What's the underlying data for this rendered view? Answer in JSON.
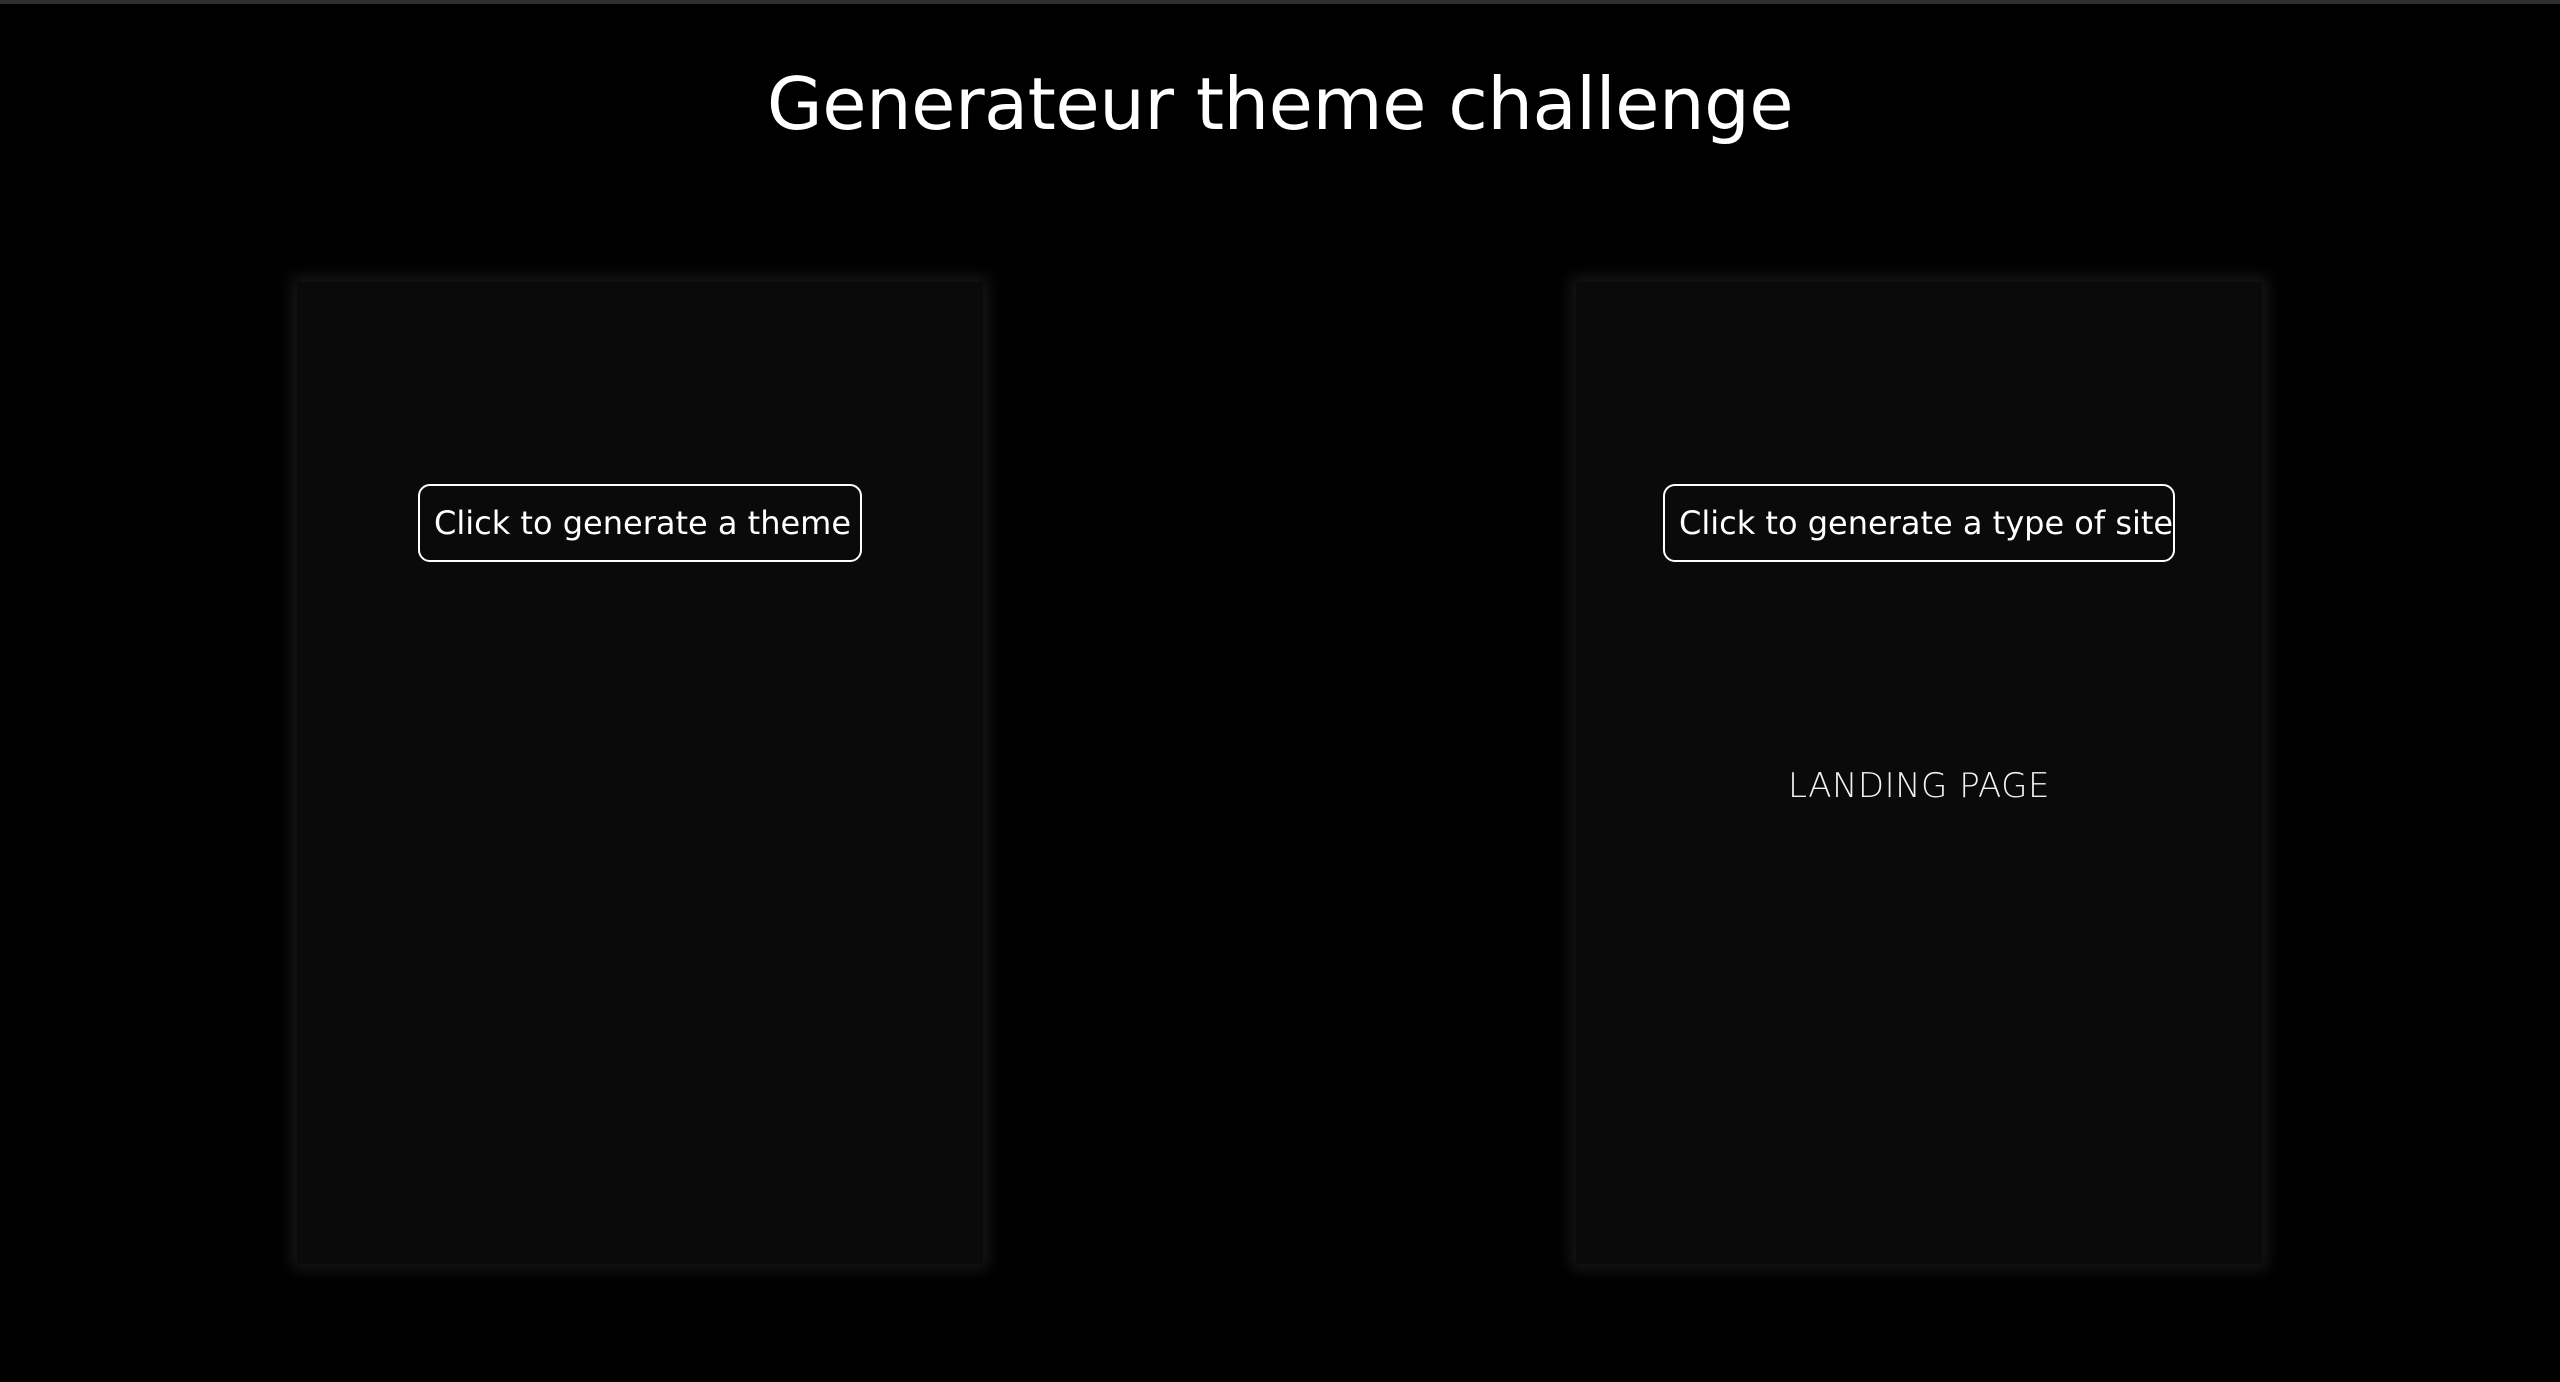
{
  "page": {
    "title": "Generateur theme challenge"
  },
  "theme_panel": {
    "button_label": "Click to generate a theme",
    "result": ""
  },
  "site_panel": {
    "button_label": "Click to generate a type of site",
    "result": "LANDING PAGE"
  },
  "colors": {
    "background": "#000000",
    "card": "#0a0a0a",
    "text": "#ffffff",
    "button_border": "#ffffff"
  }
}
